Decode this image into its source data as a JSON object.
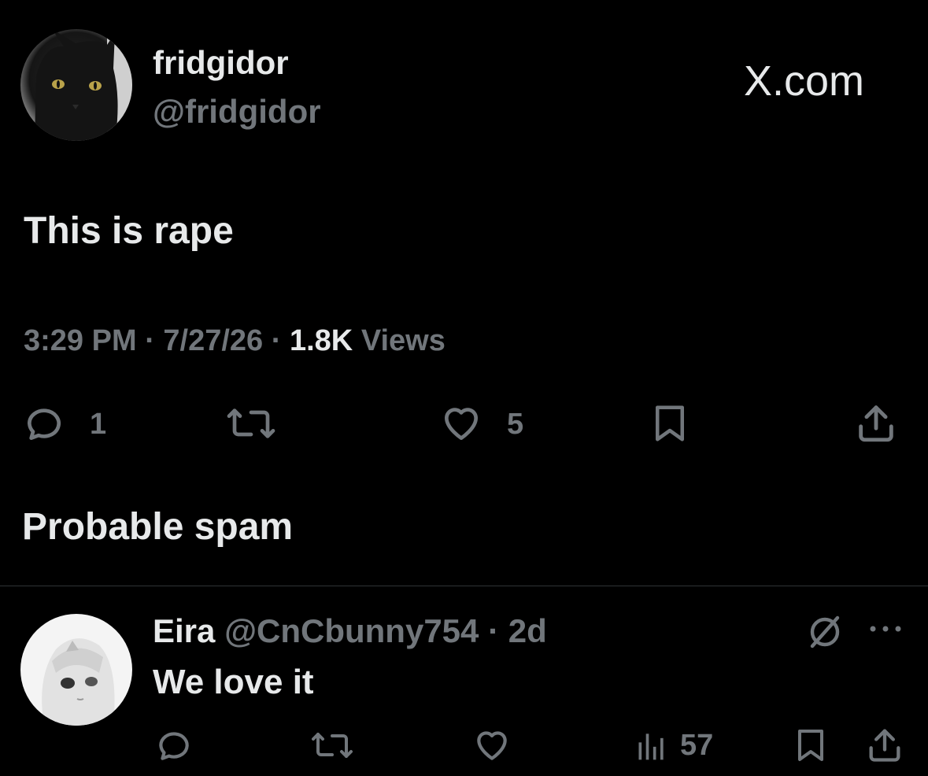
{
  "tweet": {
    "display_name": "fridgidor",
    "handle": "@fridgidor",
    "site_label": "X.com",
    "text": "This is rape",
    "time": "3:29 PM",
    "date": "7/27/26",
    "views_count": "1.8K",
    "views_label": "Views",
    "separator": "·",
    "actions": {
      "reply_count": "1",
      "retweet_count": "",
      "like_count": "5"
    }
  },
  "spam_section": {
    "label": "Probable spam"
  },
  "reply": {
    "display_name": "Eira",
    "handle": "@CnCbunny754",
    "separator": "·",
    "age": "2d",
    "text": "We love it",
    "views_count": "57"
  },
  "colors": {
    "background": "#000000",
    "text_primary": "#e7e9ea",
    "text_secondary": "#71767b",
    "divider": "#2f3336"
  }
}
